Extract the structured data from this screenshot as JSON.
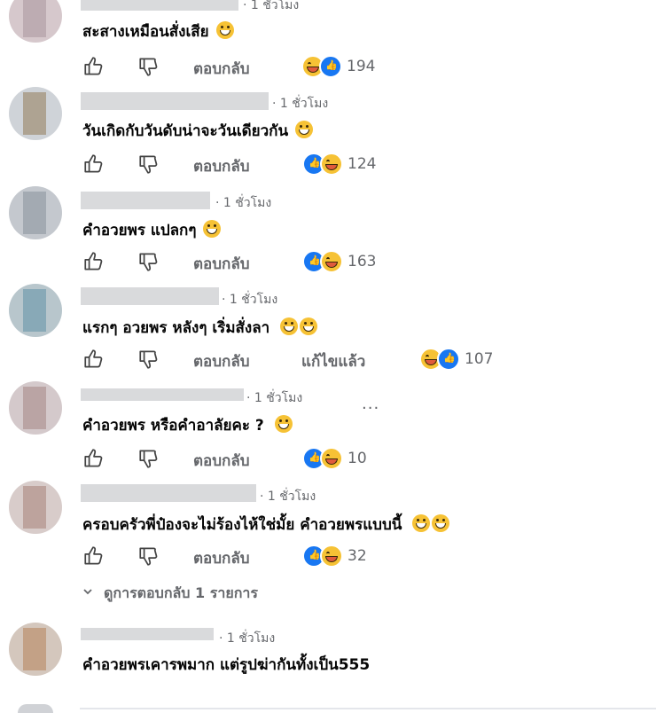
{
  "comments": [
    {
      "time": "· 1 ชั่วโมง",
      "text": "สะสางเหมือนสั่งเสีย",
      "emojis": 1,
      "reactions": [
        "haha",
        "like"
      ],
      "count": "194"
    },
    {
      "time": "· 1 ชั่วโมง",
      "text": "วันเกิดกับวันดับน่าจะวันเดียวกัน",
      "emojis": 1,
      "reactions": [
        "like",
        "haha"
      ],
      "count": "124"
    },
    {
      "time": "· 1 ชั่วโมง",
      "text": "คำอวยพร แปลกๆ",
      "emojis": 1,
      "reactions": [
        "like",
        "haha"
      ],
      "count": "163"
    },
    {
      "time": "· 1 ชั่วโมง",
      "text": "แรกๆ อวยพร หลังๆ เริ่มสั่งลา",
      "emojis": 2,
      "reactions": [
        "haha",
        "like"
      ],
      "count": "107",
      "edited": "แก้ไขแล้ว"
    },
    {
      "time": "· 1 ชั่วโมง",
      "text": "คำอวยพร หรือคำอาลัยคะ ?",
      "emojis": 1,
      "reactions": [
        "like",
        "haha"
      ],
      "count": "10"
    },
    {
      "time": "· 1 ชั่วโมง",
      "text": "ครอบครัวพี่ป๋องจะไม่ร้องไห้ใช่มั้ย คำอวยพรแบบนี้",
      "emojis": 2,
      "reactions": [
        "like",
        "haha"
      ],
      "count": "32"
    },
    {
      "time": "· 1 ชั่วโมง",
      "text": "คำอวยพรเคารพมาก แต่รูปฆ่ากันทั้งเป็น555",
      "emojis": 0
    }
  ],
  "reply_label": "ตอบกลับ",
  "more_replies": "ดูการตอบกลับ 1 รายการ",
  "more_options": "···",
  "icons": {
    "like": "thumbs-up-icon",
    "dislike": "thumbs-down-icon",
    "chevron": "chevron-down-icon"
  },
  "colors": {
    "text": "#050505",
    "muted": "#65676b",
    "like_blue": "#1877f2",
    "haha_yellow": "#f6c235"
  }
}
